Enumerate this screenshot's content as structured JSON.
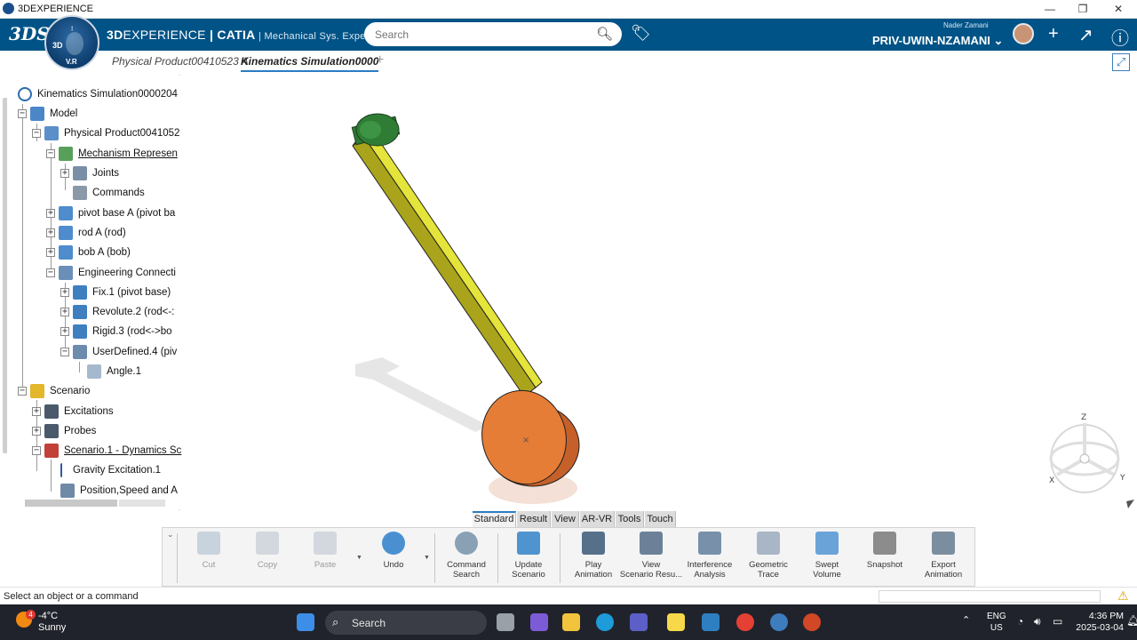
{
  "window": {
    "title": "3DEXPERIENCE",
    "controls": [
      "—",
      "❐",
      "✕"
    ]
  },
  "header": {
    "logo_mark": "3DS",
    "brand_bold": "3D",
    "brand_rest": "EXPERIENCE",
    "brand_catia": " | CATIA",
    "app_name": " | Mechanical Sys. Experie...",
    "search_placeholder": "Search",
    "user_name": "Nader Zamani",
    "tenant": "PRIV-UWIN-NZAMANI",
    "compass": {
      "label_3d": "3D",
      "label_vr": "V.R"
    },
    "icons": [
      "search-icon",
      "tag-icon",
      "add-icon",
      "share-icon",
      "help-icon"
    ]
  },
  "tabs": [
    {
      "label": "Physical Product00410523 A",
      "active": false
    },
    {
      "label": "Kinematics Simulation0000",
      "active": true
    }
  ],
  "tree": {
    "root": "Kinematics Simulation0000204",
    "nodes": [
      "Model",
      "Physical Product0041052",
      "Mechanism Represen",
      "Joints",
      "Commands",
      "pivot base A (pivot ba",
      "rod A (rod)",
      "bob A (bob)",
      "Engineering Connecti",
      "Fix.1 (pivot base)",
      "Revolute.2 (rod<-:",
      "Rigid.3 (rod<->bo",
      "UserDefined.4 (piv",
      "Angle.1",
      "Scenario",
      "Excitations",
      "Probes",
      "Scenario.1 - Dynamics Sc",
      "Gravity Excitation.1",
      "Position,Speed and A"
    ]
  },
  "compass_axes": {
    "z": "Z",
    "x": "X",
    "y": "Y"
  },
  "view_tabs": [
    "Standard",
    "Result",
    "View",
    "AR-VR",
    "Tools",
    "Touch"
  ],
  "active_view_tab": "Standard",
  "actions": [
    {
      "label": "Cut",
      "enabled": false
    },
    {
      "label": "Copy",
      "enabled": false
    },
    {
      "label": "Paste",
      "enabled": false
    },
    {
      "label": "Undo",
      "enabled": true
    },
    {
      "label": "Command\nSearch",
      "enabled": true
    },
    {
      "label": "Update\nScenario",
      "enabled": true
    },
    {
      "label": "Play\nAnimation",
      "enabled": true
    },
    {
      "label": "View\nScenario Resu...",
      "enabled": true
    },
    {
      "label": "Interference\nAnalysis",
      "enabled": true
    },
    {
      "label": "Geometric\nTrace",
      "enabled": true
    },
    {
      "label": "Swept\nVolume",
      "enabled": true
    },
    {
      "label": "Snapshot",
      "enabled": true
    },
    {
      "label": "Export\nAnimation",
      "enabled": true
    }
  ],
  "status": {
    "message": "Select an object or a command"
  },
  "taskbar": {
    "weather_badge": "4",
    "temperature": "-4°C",
    "condition": "Sunny",
    "search": "Search",
    "lang_1": "ENG",
    "lang_2": "US",
    "time": "4:36 PM",
    "date": "2025-03-04"
  },
  "colors": {
    "header_blue": "#005386",
    "rod": "#d6d62a",
    "bob": "#e57d37",
    "pivot": "#2f7d35",
    "accent": "#2a7cc3"
  }
}
